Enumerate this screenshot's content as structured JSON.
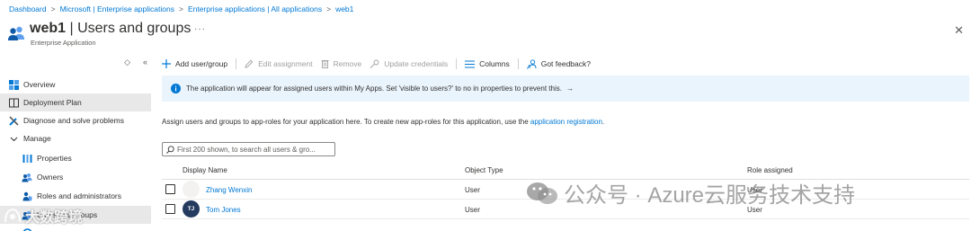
{
  "breadcrumb": [
    "Dashboard",
    "Microsoft | Enterprise applications",
    "Enterprise applications | All applications",
    "web1"
  ],
  "header": {
    "app_name": "web1",
    "page_title": "Users and groups",
    "subtitle": "Enterprise Application",
    "more": "···",
    "close": "✕"
  },
  "sidebar": {
    "tools": [
      "◇",
      "«"
    ],
    "items": [
      {
        "label": "Overview",
        "icon": "overview-grid-icon"
      },
      {
        "label": "Deployment Plan",
        "icon": "book-icon"
      },
      {
        "label": "Diagnose and solve problems",
        "icon": "wrench-icon"
      },
      {
        "label": "Manage",
        "icon": "chevron-down-icon"
      },
      {
        "label": "Properties",
        "icon": "properties-bars-icon"
      },
      {
        "label": "Owners",
        "icon": "people-icon"
      },
      {
        "label": "Roles and administrators",
        "icon": "person-shield-icon"
      },
      {
        "label": "Users and groups",
        "icon": "users-groups-icon"
      },
      {
        "label": "",
        "icon": "sso-icon"
      }
    ]
  },
  "toolbar": {
    "add": "Add user/group",
    "edit": "Edit assignment",
    "remove": "Remove",
    "update": "Update credentials",
    "columns": "Columns",
    "feedback": "Got feedback?"
  },
  "info": {
    "text": "The application will appear for assigned users within My Apps. Set 'visible to users?' to no in properties to prevent this.",
    "arrow": "→"
  },
  "description": {
    "text": "Assign users and groups to app-roles for your application here. To create new app-roles for this application, use the ",
    "link": "application registration",
    "end": "."
  },
  "search": {
    "placeholder": "First 200 shown, to search all users & gro..."
  },
  "grid": {
    "columns": [
      "Display Name",
      "Object Type",
      "Role assigned"
    ],
    "rows": [
      {
        "initials": "",
        "name": "Zhang Wenxin",
        "type": "User",
        "role": "User"
      },
      {
        "initials": "TJ",
        "name": "Tom Jones",
        "type": "User",
        "role": "User"
      }
    ]
  },
  "watermark": {
    "text": "公众号 · Azure云服务技术支持",
    "text2": "大数跨境"
  },
  "colors": {
    "accent": "#0078d4",
    "info_bg": "#eaf4fc",
    "active_bg": "#e8e8e8",
    "avatar_tj": "#243a5e"
  }
}
